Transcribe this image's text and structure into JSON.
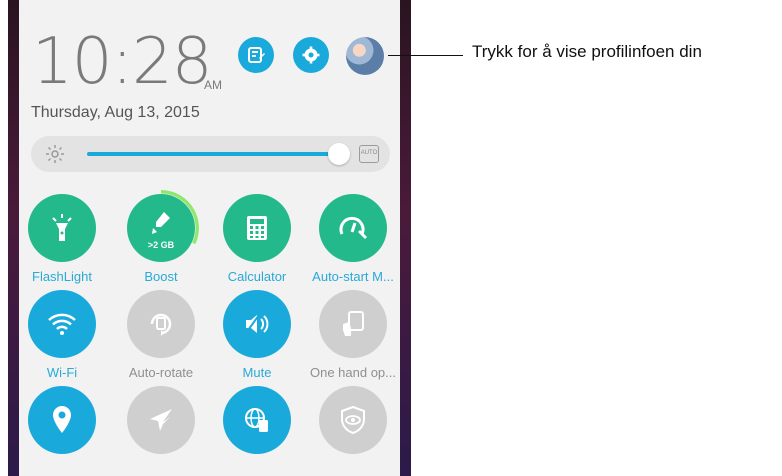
{
  "status": {
    "time": "10:28",
    "ampm": "AM",
    "date": "Thursday, Aug 13, 2015"
  },
  "brightness": {
    "auto_label": "AUTO",
    "level": 0.97
  },
  "callout": {
    "text": "Trykk for å vise profilinfoen din"
  },
  "tiles": [
    {
      "label": "FlashLight",
      "icon": "flashlight-icon",
      "state": "on"
    },
    {
      "label": "Boost",
      "icon": "boost-brush-icon",
      "state": "on",
      "badge": ">2 GB"
    },
    {
      "label": "Calculator",
      "icon": "calculator-icon",
      "state": "on"
    },
    {
      "label": "Auto-start M...",
      "icon": "auto-start-manager-icon",
      "state": "on"
    },
    {
      "label": "Wi-Fi",
      "icon": "wifi-icon",
      "state": "on"
    },
    {
      "label": "Auto-rotate",
      "icon": "auto-rotate-icon",
      "state": "off"
    },
    {
      "label": "Mute",
      "icon": "mute-icon",
      "state": "on"
    },
    {
      "label": "One hand op...",
      "icon": "one-hand-operation-icon",
      "state": "off"
    },
    {
      "label": "",
      "icon": "location-icon",
      "state": "on"
    },
    {
      "label": "",
      "icon": "airplane-icon",
      "state": "off"
    },
    {
      "label": "",
      "icon": "globe-data-icon",
      "state": "on"
    },
    {
      "label": "",
      "icon": "eye-care-icon",
      "state": "off"
    }
  ],
  "colors": {
    "accent": "#19a9db",
    "green": "#23b98b",
    "off": "#cfcfcf"
  }
}
